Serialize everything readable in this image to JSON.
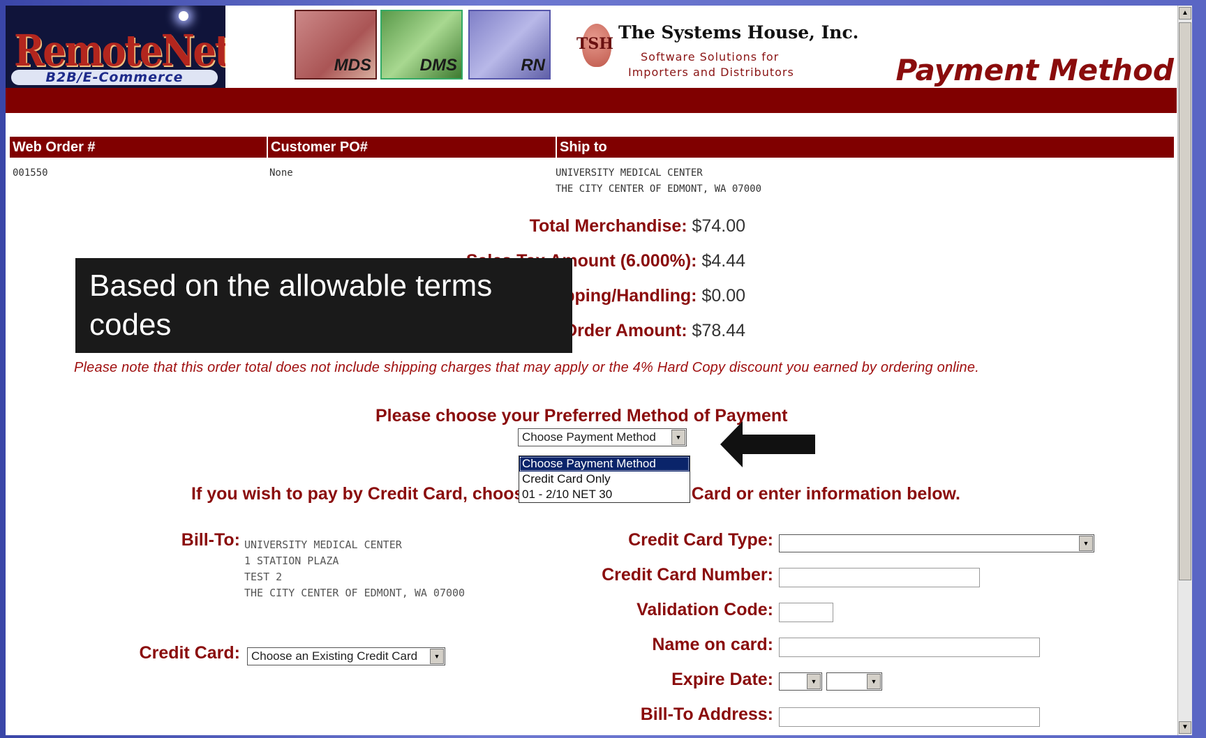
{
  "header": {
    "logo_main": "RemoteNet",
    "logo_sub": "B2B/E-Commerce",
    "tiles": [
      "MDS",
      "DMS",
      "RN"
    ],
    "company_mark": "TSH",
    "company_name": "The Systems House, Inc.",
    "company_tagline_1": "Software Solutions for",
    "company_tagline_2": "Importers and Distributors",
    "page_title": "Payment Method"
  },
  "order_table": {
    "headers": [
      "Web Order #",
      "Customer PO#",
      "Ship to"
    ],
    "web_order": "001550",
    "customer_po": "None",
    "ship_to_line1": "UNIVERSITY MEDICAL CENTER",
    "ship_to_line2": "THE CITY CENTER OF EDMONT, WA 07000"
  },
  "totals": [
    {
      "label": "Total Merchandise:",
      "value": "$74.00"
    },
    {
      "label": "Sales Tax Amount (6.000%):",
      "value": "$4.44"
    },
    {
      "label": "Shipping/Handling:",
      "value": "$0.00"
    },
    {
      "label": "Total Order Amount:",
      "value": "$78.44"
    }
  ],
  "note": "Please note that this order total does not include shipping charges that may apply or the 4% Hard Copy discount you earned by ordering online.",
  "payment": {
    "title": "Please choose your Preferred Method of Payment",
    "select_value": "Choose Payment Method",
    "options": [
      "Choose Payment Method",
      "Credit Card Only",
      "01 - 2/10 NET 30"
    ]
  },
  "credit_card_instruction": "If you wish to pay by Credit Card, choose an Existing Credit Card or enter information below.",
  "bill_to": {
    "label": "Bill-To:",
    "lines": [
      "UNIVERSITY MEDICAL CENTER",
      "1 STATION PLAZA",
      "TEST 2",
      "THE CITY CENTER OF EDMONT, WA 07000"
    ]
  },
  "credit_card": {
    "label": "Credit Card:",
    "select_value": "Choose an Existing Credit Card"
  },
  "form": {
    "card_type_label": "Credit Card Type:",
    "card_number_label": "Credit Card Number:",
    "validation_label": "Validation Code:",
    "name_label": "Name on card:",
    "expire_label": "Expire Date:",
    "bill_address_label": "Bill-To Address:"
  },
  "callout": "Based on the allowable terms codes",
  "colors": {
    "brand_red": "#800000",
    "text_red": "#8a0c0c",
    "slide_blue": "#4a57b8"
  }
}
